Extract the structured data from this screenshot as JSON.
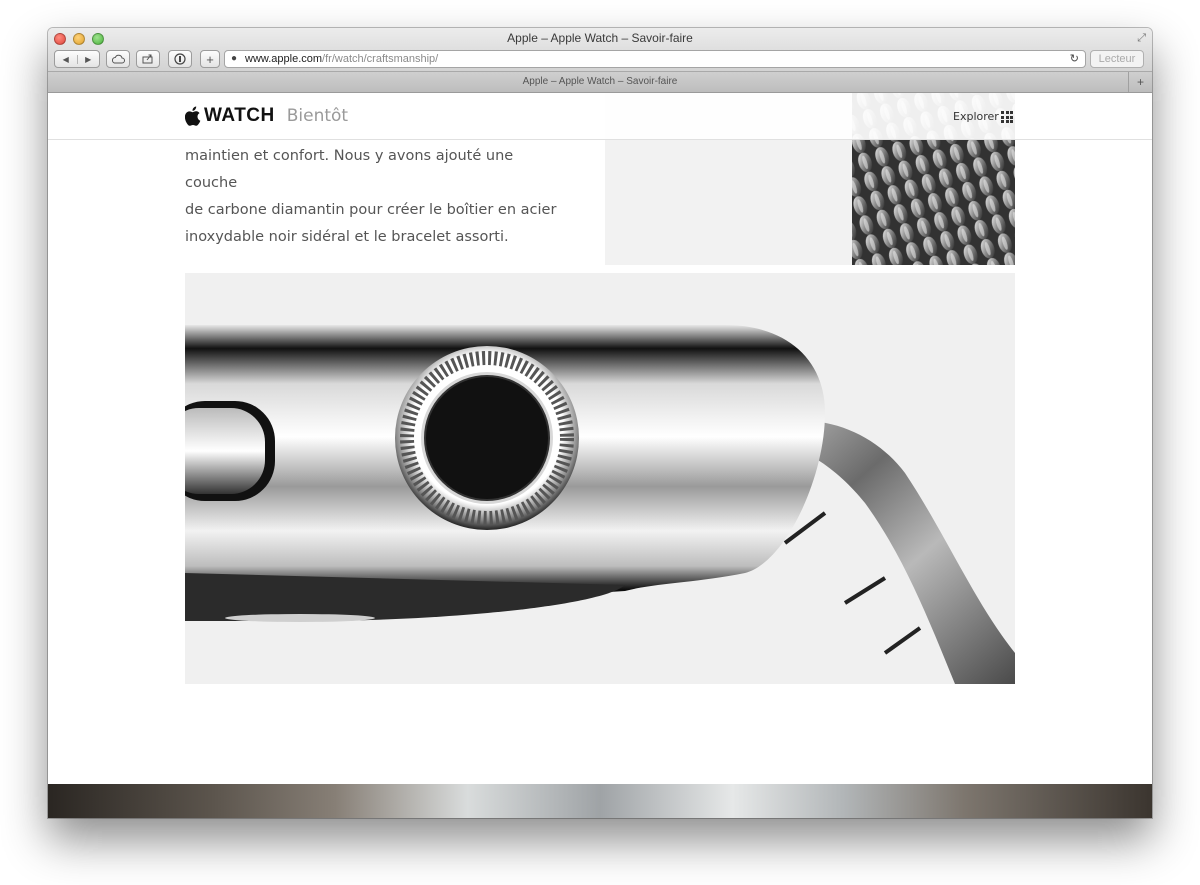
{
  "browser": {
    "window_title": "Apple – Apple Watch – Savoir-faire",
    "tab_title": "Apple – Apple Watch – Savoir-faire",
    "address": {
      "domain": "www.apple.com",
      "path": "/fr/watch/craftsmanship/"
    },
    "reader_label": "Lecteur",
    "new_tab_symbol": "+",
    "add_symbol": "+",
    "back_symbol": "◀",
    "forward_symbol": "▶",
    "reload_symbol": "↻"
  },
  "localnav": {
    "brand": "WATCH",
    "subtitle": "Bientôt",
    "explorer_label": "Explorer"
  },
  "content": {
    "ghost_lines": [
      "",
      ""
    ],
    "paragraph_lines": [
      "maintien et confort. Nous y avons ajouté une couche",
      "de carbone diamantin pour créer le boîtier en acier",
      "inoxydable noir sidéral et le bracelet assorti."
    ]
  },
  "icons": {
    "apple_logo": "apple-logo-icon",
    "explorer_grid": "grid-icon",
    "icloud": "cloud-icon",
    "share": "share-icon",
    "reader": "reader-icon"
  }
}
